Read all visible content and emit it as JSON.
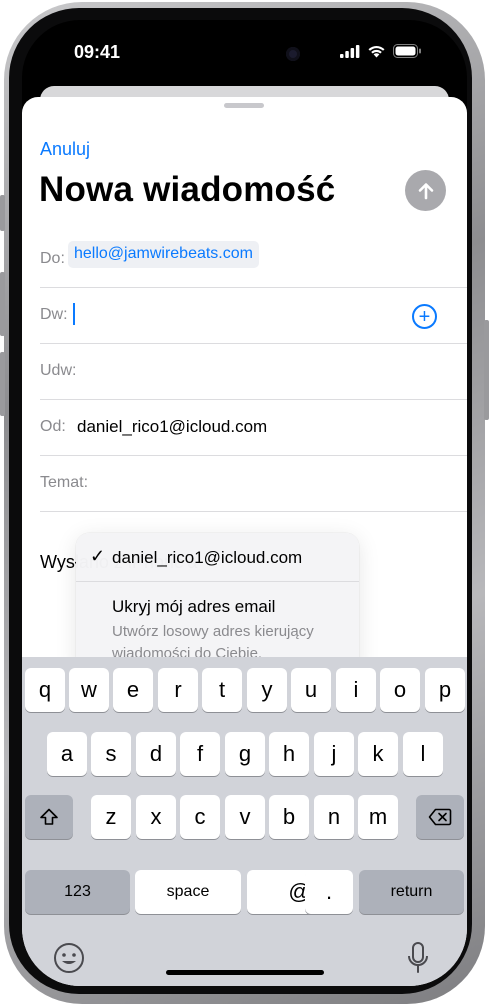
{
  "status_bar": {
    "time": "09:41"
  },
  "compose": {
    "cancel_label": "Anuluj",
    "title": "Nowa wiadomość",
    "to_label": "Do:",
    "to_value": "hello@jamwirebeats.com",
    "cc_label": "Dw:",
    "bcc_label": "Udw:",
    "from_label": "Od:",
    "from_value": "daniel_rico1@icloud.com",
    "subject_label": "Temat:",
    "body_text": "Wysłano z iPhone'a"
  },
  "from_menu": {
    "selected": "daniel_rico1@icloud.com",
    "hide_label": "Ukryj mój adres email",
    "hide_desc": "Utwórz losowy adres kierujący wiadomości do Ciebie."
  },
  "keyboard": {
    "row1": [
      "q",
      "w",
      "e",
      "r",
      "t",
      "y",
      "u",
      "i",
      "o",
      "p"
    ],
    "row2": [
      "a",
      "s",
      "d",
      "f",
      "g",
      "h",
      "j",
      "k",
      "l"
    ],
    "row3": [
      "z",
      "x",
      "c",
      "v",
      "b",
      "n",
      "m"
    ],
    "numbers_label": "123",
    "space_label": "space",
    "at_label": "@",
    "dot_label": ".",
    "return_label": "return"
  },
  "colors": {
    "accent": "#0a7aff",
    "keyboard_bg": "#d1d3d9",
    "send_button": "#a9a9ad"
  }
}
